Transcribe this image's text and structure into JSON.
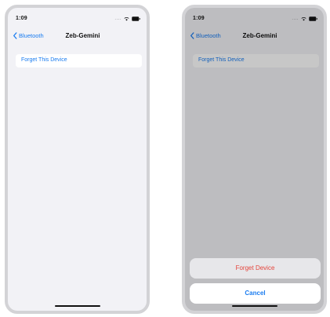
{
  "colors": {
    "accent": "#1a7cf0",
    "destructive": "#e5453c",
    "background": "#f2f2f6"
  },
  "left_screen": {
    "status": {
      "time": "1:09",
      "signal": "...."
    },
    "nav": {
      "back_label": "Bluetooth",
      "title": "Zeb-Gemini"
    },
    "forget_cell_label": "Forget This Device"
  },
  "right_screen": {
    "status": {
      "time": "1:09",
      "signal": "...."
    },
    "nav": {
      "back_label": "Bluetooth",
      "title": "Zeb-Gemini"
    },
    "forget_cell_label": "Forget This Device",
    "action_sheet": {
      "destructive_label": "Forget Device",
      "cancel_label": "Cancel"
    }
  }
}
